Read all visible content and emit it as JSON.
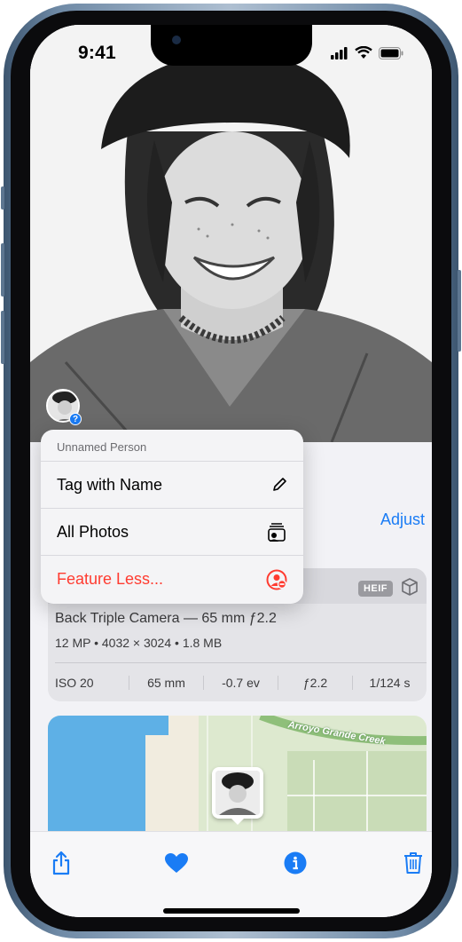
{
  "status_bar": {
    "time": "9:41"
  },
  "menu": {
    "header": "Unnamed Person",
    "items": [
      {
        "label": "Tag with Name",
        "icon": "pencil-icon"
      },
      {
        "label": "All Photos",
        "icon": "photo-stack-person-icon"
      },
      {
        "label": "Feature Less...",
        "icon": "person-minus-icon",
        "destructive": true
      }
    ]
  },
  "info": {
    "adjust_label": "Adjust",
    "badge": "HEIF",
    "camera_line": "Back Triple Camera — 65 mm ƒ2.2",
    "file_line": "12 MP • 4032 × 3024 • 1.8 MB",
    "specs": [
      "ISO 20",
      "65 mm",
      "-0.7 ev",
      "ƒ2.2",
      "1/124 s"
    ]
  },
  "map": {
    "place_label": "Arroyo Grande Creek"
  },
  "toolbar": {
    "items": [
      "share-icon",
      "heart-icon",
      "info-icon",
      "trash-icon"
    ]
  },
  "colors": {
    "accent": "#1a7cf5",
    "destructive": "#ff3b30"
  }
}
